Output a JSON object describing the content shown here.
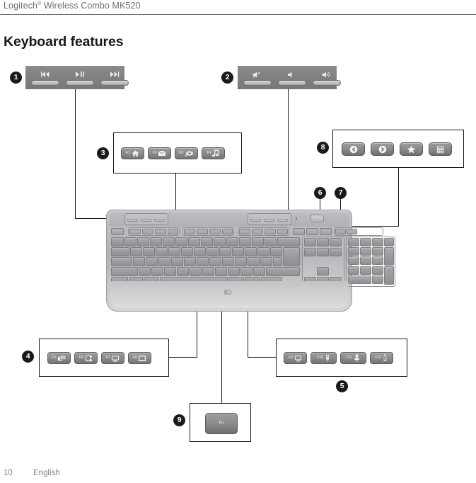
{
  "header": {
    "brand": "Logitech",
    "registered_mark": "®",
    "product": " Wireless Combo MK520"
  },
  "page": {
    "title": "Keyboard features",
    "page_number": "10",
    "language": "English"
  },
  "callouts": [
    {
      "number": "1",
      "badge": "❶",
      "type": "media-strip",
      "keys": [
        {
          "name": "previous-track-key",
          "glyph": "⏮"
        },
        {
          "name": "play-pause-key",
          "glyph": "▶❘❘"
        },
        {
          "name": "next-track-key",
          "glyph": "⏭"
        }
      ]
    },
    {
      "number": "2",
      "badge": "❷",
      "type": "volume-strip",
      "keys": [
        {
          "name": "mute-key",
          "glyph": "mute"
        },
        {
          "name": "volume-down-key",
          "glyph": "ὐ8"
        },
        {
          "name": "volume-up-key",
          "glyph": "ὐ9"
        }
      ]
    },
    {
      "number": "3",
      "badge": "❸",
      "type": "fkey-row",
      "keys": [
        {
          "name": "f1-home-key",
          "label": "F1",
          "glyph": "home"
        },
        {
          "name": "f2-mail-key",
          "label": "F2",
          "glyph": "envelope"
        },
        {
          "name": "f3-search-key",
          "label": "F3",
          "glyph": "search"
        },
        {
          "name": "f4-music-key",
          "label": "F4",
          "glyph": "music-note"
        }
      ]
    },
    {
      "number": "4",
      "badge": "❹",
      "type": "fkey-row",
      "keys": [
        {
          "name": "f5-switch-window-key",
          "label": "F5",
          "glyph": "windows-switch"
        },
        {
          "name": "f6-application-key",
          "label": "F6",
          "glyph": "app-window"
        },
        {
          "name": "f7-display-key",
          "label": "F7",
          "glyph": "monitor"
        },
        {
          "name": "f8-window-key",
          "label": "F8",
          "glyph": "window-box"
        }
      ]
    },
    {
      "number": "5",
      "badge": "❺",
      "type": "fkey-row",
      "keys": [
        {
          "name": "f9-my-computer-key",
          "label": "F9",
          "glyph": "computer"
        },
        {
          "name": "f10-document-key",
          "label": "F10",
          "glyph": "document"
        },
        {
          "name": "f11-user-key",
          "label": "F11",
          "glyph": "user"
        },
        {
          "name": "f12-battery-key",
          "label": "F12",
          "glyph": "battery"
        }
      ]
    },
    {
      "number": "6",
      "badge": "❻",
      "type": "pointer",
      "target": "battery-status-led"
    },
    {
      "number": "7",
      "badge": "❼",
      "type": "pointer",
      "target": "power-switch"
    },
    {
      "number": "8",
      "badge": "❽",
      "type": "bigkey-row",
      "keys": [
        {
          "name": "back-key",
          "glyph": "arrow-left-circle"
        },
        {
          "name": "forward-key",
          "glyph": "arrow-right-circle"
        },
        {
          "name": "favorites-key",
          "glyph": "star"
        },
        {
          "name": "calculator-key",
          "glyph": "calculator"
        }
      ]
    },
    {
      "number": "9",
      "badge": "❾",
      "type": "single-key",
      "keys": [
        {
          "name": "fn-key",
          "label": "Fn"
        }
      ]
    }
  ],
  "keyboard": {
    "name": "logitech-k520-keyboard",
    "brand_logo": "logitech",
    "indicator_name": "battery-led",
    "power_switch_name": "power-switch"
  },
  "colors": {
    "line": "#1a1a1a",
    "badge_bg": "#1a1a1a",
    "badge_fg": "#ffffff",
    "header_text": "#6d6e71",
    "title_text": "#1a1a1a",
    "footer_text": "#808285"
  }
}
